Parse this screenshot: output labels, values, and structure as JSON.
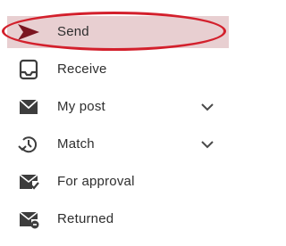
{
  "menu": {
    "items": [
      {
        "label": "Send",
        "icon": "send-arrow-icon",
        "active": true,
        "expandable": false
      },
      {
        "label": "Receive",
        "icon": "inbox-tray-icon",
        "active": false,
        "expandable": false
      },
      {
        "label": "My post",
        "icon": "envelope-icon",
        "active": false,
        "expandable": true
      },
      {
        "label": "Match",
        "icon": "clock-arrow-icon",
        "active": false,
        "expandable": true
      },
      {
        "label": "For approval",
        "icon": "envelope-check-icon",
        "active": false,
        "expandable": false
      },
      {
        "label": "Returned",
        "icon": "envelope-return-icon",
        "active": false,
        "expandable": false
      }
    ]
  },
  "colors": {
    "accent": "#d3202c",
    "active_bg": "#e8cfd1",
    "icon": "#3d3d3d",
    "text": "#2e2e2e"
  }
}
